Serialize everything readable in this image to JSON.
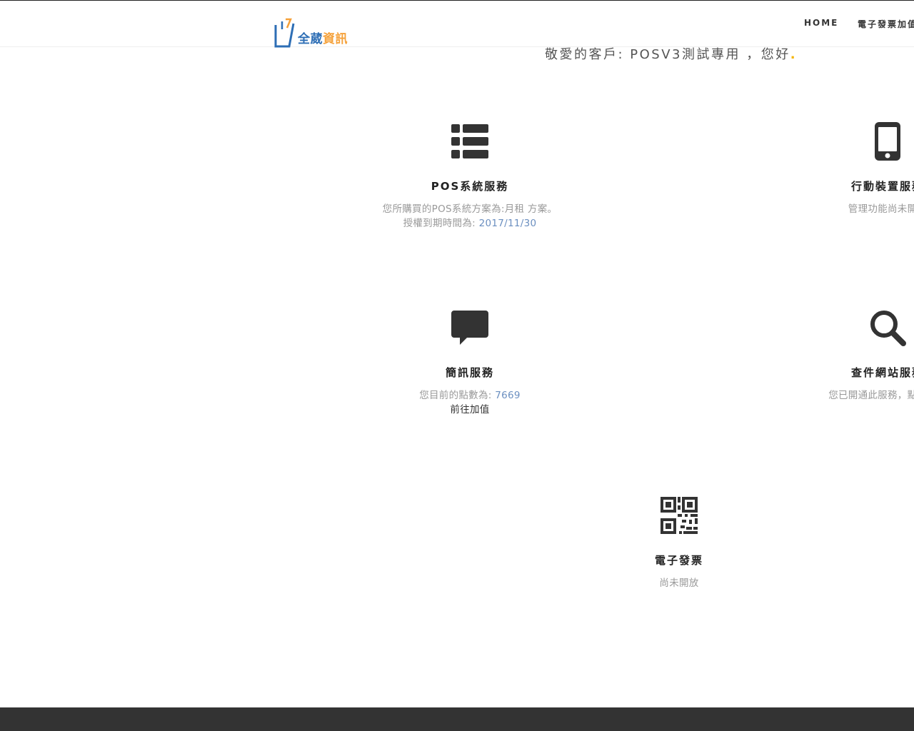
{
  "logo": {
    "text_blue": "全葳",
    "text_orange": "資訊"
  },
  "nav": {
    "home": "HOME",
    "einvoice": "電子發票加值"
  },
  "greeting": {
    "text": "敬愛的客戶: POSV3測試專用 ，您好",
    "dot": "."
  },
  "services": {
    "pos": {
      "icon": "list-icon",
      "title": "POS系統服務",
      "line1_prefix": "您所購買的",
      "line1_highlight": "POS系統方案為:月租 方案。",
      "line2_prefix": "授權到期時間為: ",
      "line2_value": "2017/11/30"
    },
    "mobile": {
      "icon": "mobile-phone-icon",
      "title": "行動裝置服務",
      "desc": "管理功能尚未開放"
    },
    "sms": {
      "icon": "chat-bubble-icon",
      "title": "簡訊服務",
      "points_prefix": "您目前的點數為: ",
      "points_value": "7669",
      "topup_link": "前往加值"
    },
    "search": {
      "icon": "search-icon",
      "title": "查件網站服務",
      "desc": "您已開通此服務，點此前往"
    },
    "einvoice": {
      "icon": "qr-code-icon",
      "title": "電子發票",
      "desc": "尚未開放"
    }
  },
  "colors": {
    "accent_blue": "#2d6eb5",
    "accent_orange": "#f5a13a",
    "highlight": "#6b8fc0",
    "footer": "#333333"
  }
}
